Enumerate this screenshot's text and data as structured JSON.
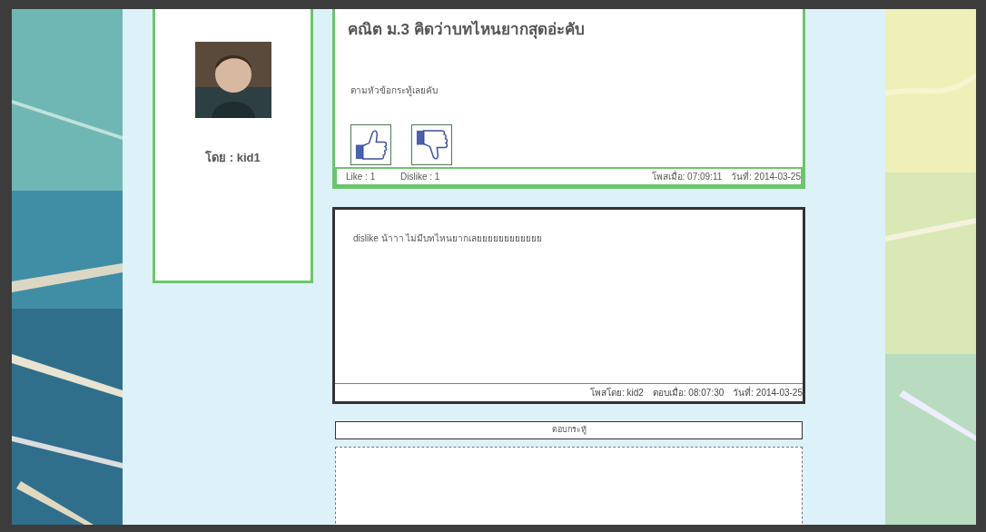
{
  "author_panel": {
    "byline": "โดย : kid1"
  },
  "post": {
    "title": "คณิต ม.3 คิดว่าบทไหนยากสุดอ่ะคับ",
    "body": "ตามหัวข้อกระทู้เลยคับ",
    "like_label": "Like : 1",
    "dislike_label": "Dislike : 1",
    "posted_at": "โพสเมื่อ: 07:09:11",
    "date": "วันที่: 2014-03-25"
  },
  "comments": [
    {
      "text": "dislike น้าาา ไม่มีบทไหนยากเลยยยยยยยยยยยย",
      "posted_by": "โพสโดย: kid2",
      "replied_at": "ตอบเมื่อ: 08:07:30",
      "date": "วันที่: 2014-03-25"
    }
  ],
  "reply": {
    "header": "ตอบกระทู้"
  }
}
